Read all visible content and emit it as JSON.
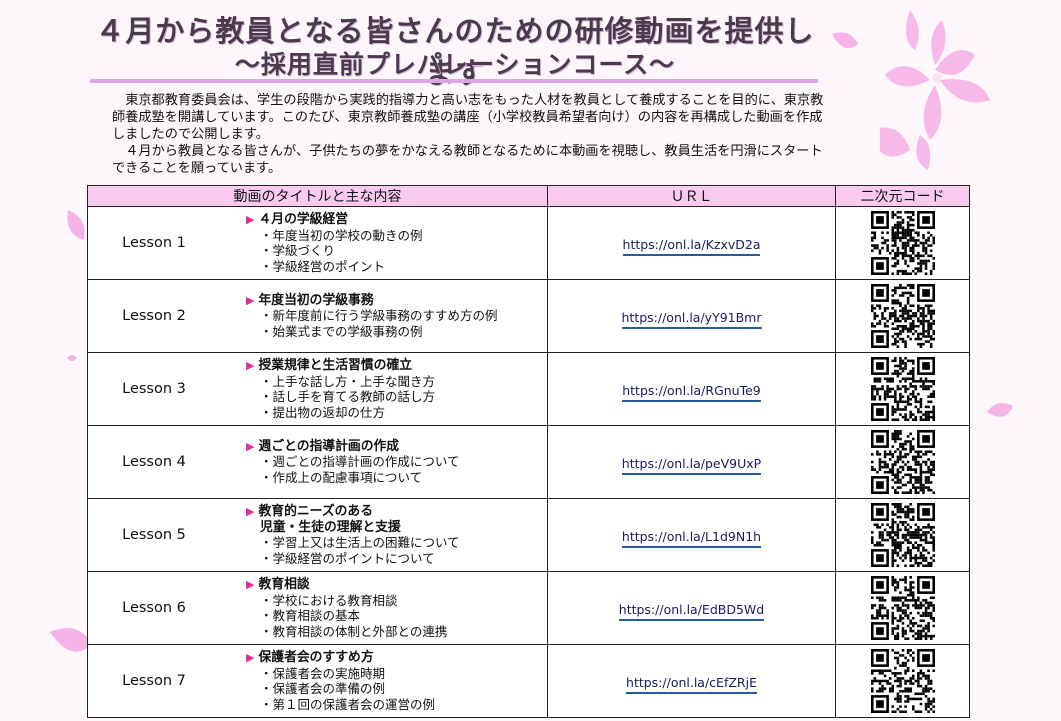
{
  "header": {
    "title": "４月から教員となる皆さんのための研修動画を提供します",
    "subtitle": "～採用直前プレパレーションコース～"
  },
  "intro": {
    "paragraph1": "東京都教育委員会は、学生の段階から実践的指導力と高い志をもった人材を教員として養成することを目的に、東京教師養成塾を開講しています。このたび、東京教師養成塾の講座（小学校教員希望者向け）の内容を再構成した動画を作成しましたので公開します。",
    "paragraph2": "４月から教員となる皆さんが、子供たちの夢をかなえる教師となるために本動画を視聴し、教員生活を円滑にスタートできることを願っています。"
  },
  "table": {
    "headers": {
      "content": "動画のタイトルと主な内容",
      "url": "ＵＲＬ",
      "qr": "二次元コード"
    },
    "rows": [
      {
        "lesson": "Lesson 1",
        "title": "４月の学級経営",
        "title2": "",
        "items": [
          "・年度当初の学校の動きの例",
          "・学級づくり",
          "・学級経営のポイント"
        ],
        "url": "https://onl.la/KzxvD2a"
      },
      {
        "lesson": "Lesson 2",
        "title": "年度当初の学級事務",
        "title2": "",
        "items": [
          "・新年度前に行う学級事務のすすめ方の例",
          "・始業式までの学級事務の例"
        ],
        "url": "https://onl.la/yY91Bmr"
      },
      {
        "lesson": "Lesson 3",
        "title": "授業規律と生活習慣の確立",
        "title2": "",
        "items": [
          "・上手な話し方・上手な聞き方",
          "・話し手を育てる教師の話し方",
          "・提出物の返却の仕方"
        ],
        "url": "https://onl.la/RGnuTe9"
      },
      {
        "lesson": "Lesson 4",
        "title": "週ごとの指導計画の作成",
        "title2": "",
        "items": [
          "・週ごとの指導計画の作成について",
          "・作成上の配慮事項について"
        ],
        "url": "https://onl.la/peV9UxP"
      },
      {
        "lesson": "Lesson 5",
        "title": "教育的ニーズのある",
        "title2": "児童・生徒の理解と支援",
        "items": [
          "・学習上又は生活上の困難について",
          "・学級経営のポイントについて"
        ],
        "url": "https://onl.la/L1d9N1h"
      },
      {
        "lesson": "Lesson 6",
        "title": "教育相談",
        "title2": "",
        "items": [
          "・学校における教育相談",
          "・教育相談の基本",
          "・教育相談の体制と外部との連携"
        ],
        "url": "https://onl.la/EdBD5Wd"
      },
      {
        "lesson": "Lesson 7",
        "title": "保護者会のすすめ方",
        "title2": "",
        "items": [
          "・保護者会の実施時期",
          "・保護者会の準備の例",
          "・第１回の保護者会の運営の例"
        ],
        "url": "https://onl.la/cEfZRjE"
      }
    ]
  },
  "colors": {
    "header_bg": "#f9c9ef",
    "accent_arrow": "#e0309a",
    "petal": "#f6a8e4",
    "url_underline": "#2a5a9a"
  },
  "icons": {
    "arrow": "▶",
    "decoration": "sakura-petal-icon",
    "qr": "qr-code-icon"
  }
}
